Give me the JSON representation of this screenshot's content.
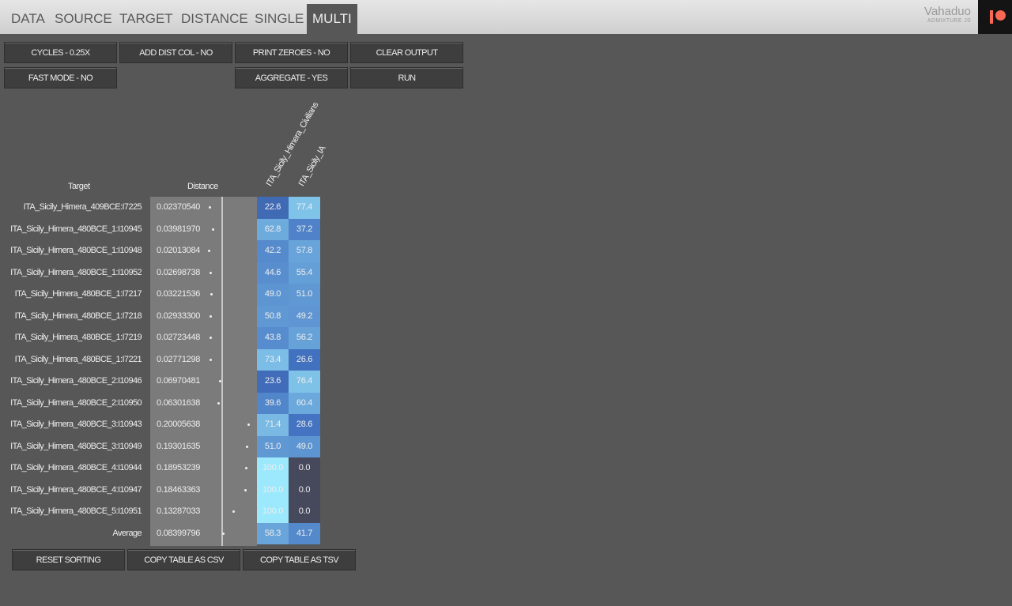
{
  "nav": {
    "tabs": [
      "DATA",
      "SOURCE",
      "TARGET",
      "DISTANCE",
      "SINGLE",
      "MULTI"
    ],
    "active": "MULTI"
  },
  "brand": {
    "name": "Vahaduo",
    "subtitle": "ADMIXTURE JS",
    "patreon_icon": "patreon-icon"
  },
  "controls": {
    "cycles": "CYCLES - 0.25X",
    "add_dist_col": "ADD DIST COL - NO",
    "print_zeroes": "PRINT ZEROES - NO",
    "clear_output": "CLEAR OUTPUT",
    "fast_mode": "FAST MODE - NO",
    "aggregate": "AGGREGATE - YES",
    "run": "RUN"
  },
  "table": {
    "headers": {
      "target": "Target",
      "distance": "Distance"
    },
    "source_columns": [
      "ITA_Sicily_Himera_Civilians",
      "ITA_Sicily_IA"
    ],
    "rows": [
      {
        "target": "ITA_Sicily_Himera_409BCE:I7225",
        "distance": "0.02370540",
        "v1": "22.6",
        "v2": "77.4"
      },
      {
        "target": "ITA_Sicily_Himera_480BCE_1:I10945",
        "distance": "0.03981970",
        "v1": "62.8",
        "v2": "37.2"
      },
      {
        "target": "ITA_Sicily_Himera_480BCE_1:I10948",
        "distance": "0.02013084",
        "v1": "42.2",
        "v2": "57.8"
      },
      {
        "target": "ITA_Sicily_Himera_480BCE_1:I10952",
        "distance": "0.02698738",
        "v1": "44.6",
        "v2": "55.4"
      },
      {
        "target": "ITA_Sicily_Himera_480BCE_1:I7217",
        "distance": "0.03221536",
        "v1": "49.0",
        "v2": "51.0"
      },
      {
        "target": "ITA_Sicily_Himera_480BCE_1:I7218",
        "distance": "0.02933300",
        "v1": "50.8",
        "v2": "49.2"
      },
      {
        "target": "ITA_Sicily_Himera_480BCE_1:I7219",
        "distance": "0.02723448",
        "v1": "43.8",
        "v2": "56.2"
      },
      {
        "target": "ITA_Sicily_Himera_480BCE_1:I7221",
        "distance": "0.02771298",
        "v1": "73.4",
        "v2": "26.6"
      },
      {
        "target": "ITA_Sicily_Himera_480BCE_2:I10946",
        "distance": "0.06970481",
        "v1": "23.6",
        "v2": "76.4"
      },
      {
        "target": "ITA_Sicily_Himera_480BCE_2:I10950",
        "distance": "0.06301638",
        "v1": "39.6",
        "v2": "60.4"
      },
      {
        "target": "ITA_Sicily_Himera_480BCE_3:I10943",
        "distance": "0.20005638",
        "v1": "71.4",
        "v2": "28.6"
      },
      {
        "target": "ITA_Sicily_Himera_480BCE_3:I10949",
        "distance": "0.19301635",
        "v1": "51.0",
        "v2": "49.0"
      },
      {
        "target": "ITA_Sicily_Himera_480BCE_4:I10944",
        "distance": "0.18953239",
        "v1": "100.0",
        "v2": "0.0"
      },
      {
        "target": "ITA_Sicily_Himera_480BCE_4:I10947",
        "distance": "0.18463363",
        "v1": "100.0",
        "v2": "0.0"
      },
      {
        "target": "ITA_Sicily_Himera_480BCE_5:I10951",
        "distance": "0.13287033",
        "v1": "100.0",
        "v2": "0.0"
      }
    ],
    "average": {
      "target": "Average",
      "distance": "0.08399796",
      "v1": "58.3",
      "v2": "41.7"
    }
  },
  "footer": {
    "reset_sorting": "RESET SORTING",
    "copy_csv": "COPY TABLE AS CSV",
    "copy_tsv": "COPY TABLE AS TSV"
  }
}
